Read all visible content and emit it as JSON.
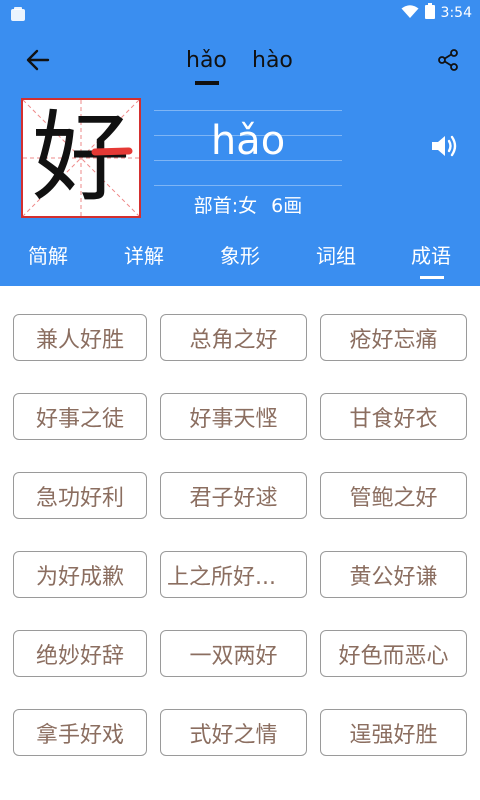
{
  "status_bar": {
    "time": "3:54",
    "icons": [
      "sim-icon",
      "wifi-icon",
      "battery-icon"
    ]
  },
  "toolbar": {
    "back_icon": "arrow-left-icon",
    "share_icon": "share-icon",
    "pronunciations": [
      "hǎo",
      "hào"
    ],
    "selected_pronunciation": "hǎo"
  },
  "character": {
    "glyph": "好",
    "pinyin": "hǎo",
    "radical": "部首:女",
    "strokes": "6画",
    "speaker_icon": "speaker-icon"
  },
  "sections": {
    "tabs": [
      "简解",
      "详解",
      "象形",
      "词组",
      "成语"
    ],
    "selected": "成语"
  },
  "idioms": [
    "兼人好胜",
    "总角之好",
    "疮好忘痛",
    "好事之徒",
    "好事天悭",
    "甘食好衣",
    "急功好利",
    "君子好逑",
    "管鲍之好",
    "为好成歉",
    "上之所好...",
    "黄公好谦",
    "绝妙好辞",
    "一双两好",
    "好色而恶心",
    "拿手好戏",
    "式好之情",
    "逞强好胜"
  ],
  "colors": {
    "header_blue": "#3a8ef0",
    "idiom_text": "#8b6e60",
    "idiom_border": "#9a9a9a",
    "char_box_border": "#d32f2f",
    "stroke_highlight": "#e53935"
  }
}
